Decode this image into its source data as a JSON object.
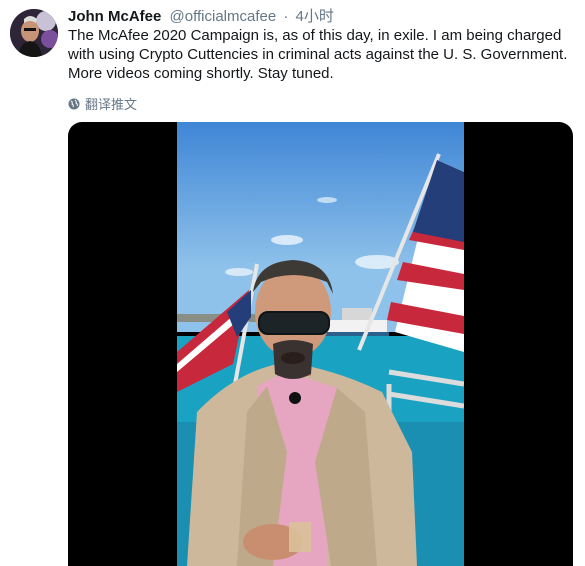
{
  "tweet": {
    "author_name": "John McAfee",
    "author_handle": "@officialmcafee",
    "separator": "·",
    "time": "4小时",
    "text": "The McAfee 2020 Campaign is, as of this day, in exile. I am being charged with using Crypto Cuttencies in  criminal acts against the U. S. Government. More videos coming shortly. Stay tuned.",
    "translate_label": "翻译推文"
  },
  "colors": {
    "secondary_text": "#657786",
    "sky": "#4a8fd8",
    "water": "#1ba6c4"
  },
  "icons": {
    "translate": "globe-icon"
  }
}
